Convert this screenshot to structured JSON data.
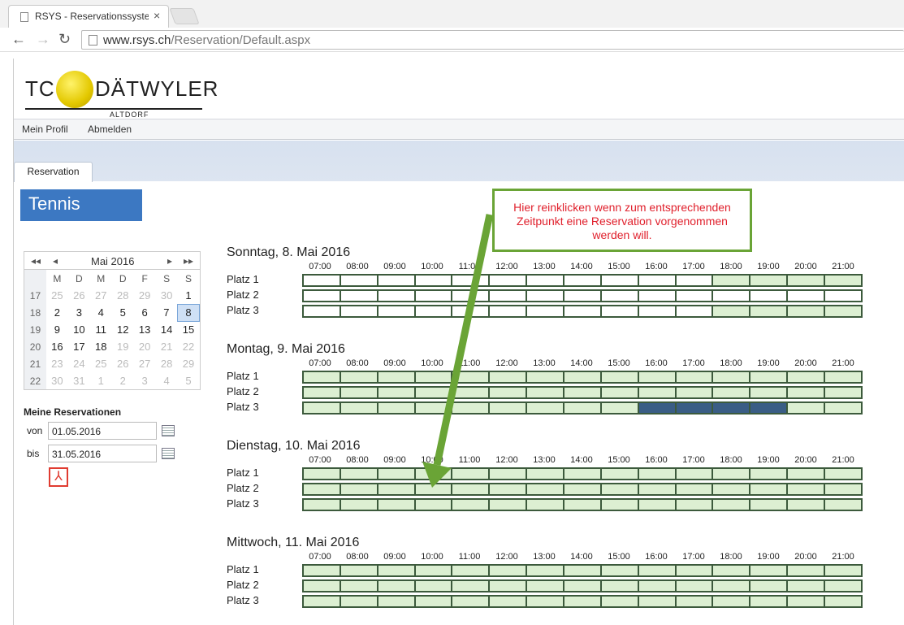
{
  "browser": {
    "tab_title": "RSYS - Reservationssyster",
    "url_host": "www.rsys.ch",
    "url_path": "/Reservation/Default.aspx"
  },
  "logo": {
    "tc": "TC",
    "name": "DÄTWYLER",
    "place": "ALTDORF"
  },
  "menu": {
    "profile": "Mein Profil",
    "logout": "Abmelden"
  },
  "tabs": {
    "reservation": "Reservation"
  },
  "section_title": "Tennis",
  "calendar": {
    "prev_year": "◂◂",
    "prev": "◂",
    "month": "Mai 2016",
    "next": "▸",
    "next_year": "▸▸",
    "dow": [
      "M",
      "D",
      "M",
      "D",
      "F",
      "S",
      "S"
    ],
    "weeks": [
      {
        "wk": "17",
        "days": [
          "25",
          "26",
          "27",
          "28",
          "29",
          "30",
          "1"
        ],
        "dim": [
          1,
          1,
          1,
          1,
          1,
          1,
          0
        ]
      },
      {
        "wk": "18",
        "days": [
          "2",
          "3",
          "4",
          "5",
          "6",
          "7",
          "8"
        ],
        "dim": [
          0,
          0,
          0,
          0,
          0,
          0,
          0
        ],
        "sel": 6
      },
      {
        "wk": "19",
        "days": [
          "9",
          "10",
          "11",
          "12",
          "13",
          "14",
          "15"
        ],
        "dim": [
          0,
          0,
          0,
          0,
          0,
          0,
          0
        ]
      },
      {
        "wk": "20",
        "days": [
          "16",
          "17",
          "18",
          "19",
          "20",
          "21",
          "22"
        ],
        "dim": [
          0,
          0,
          0,
          1,
          1,
          1,
          1
        ]
      },
      {
        "wk": "21",
        "days": [
          "23",
          "24",
          "25",
          "26",
          "27",
          "28",
          "29"
        ],
        "dim": [
          1,
          1,
          1,
          1,
          1,
          1,
          1
        ]
      },
      {
        "wk": "22",
        "days": [
          "30",
          "31",
          "1",
          "2",
          "3",
          "4",
          "5"
        ],
        "dim": [
          1,
          1,
          1,
          1,
          1,
          1,
          1
        ]
      }
    ]
  },
  "my_reservations": {
    "title": "Meine Reservationen",
    "from_label": "von",
    "from": "01.05.2016",
    "to_label": "bis",
    "to": "31.05.2016"
  },
  "hours": [
    "07:00",
    "08:00",
    "09:00",
    "10:00",
    "11:00",
    "12:00",
    "13:00",
    "14:00",
    "15:00",
    "16:00",
    "17:00",
    "18:00",
    "19:00",
    "20:00",
    "21:00"
  ],
  "days": [
    {
      "title": "Sonntag, 8. Mai 2016",
      "courts": [
        {
          "name": "Platz 1",
          "slots": "fffffffffffgggg"
        },
        {
          "name": "Platz 2",
          "slots": "fffffffffffffff"
        },
        {
          "name": "Platz 3",
          "slots": "fffffffffffgggg"
        }
      ]
    },
    {
      "title": "Montag, 9. Mai 2016",
      "courts": [
        {
          "name": "Platz 1",
          "slots": "ggggggggggggggg"
        },
        {
          "name": "Platz 2",
          "slots": "ggggggggggggggg"
        },
        {
          "name": "Platz 3",
          "slots": "gggggggggbbbbgg"
        }
      ]
    },
    {
      "title": "Dienstag, 10. Mai 2016",
      "courts": [
        {
          "name": "Platz 1",
          "slots": "ggggggggggggggg"
        },
        {
          "name": "Platz 2",
          "slots": "ggggggggggggggg"
        },
        {
          "name": "Platz 3",
          "slots": "ggggggggggggggg"
        }
      ]
    },
    {
      "title": "Mittwoch, 11. Mai 2016",
      "courts": [
        {
          "name": "Platz 1",
          "slots": "ggggggggggggggg"
        },
        {
          "name": "Platz 2",
          "slots": "ggggggggggggggg"
        },
        {
          "name": "Platz 3",
          "slots": "ggggggggggggggg"
        }
      ]
    }
  ],
  "callout": "Hier reinklicken wenn zum entsprechenden Zeitpunkt eine Reservation vorgenommen werden will."
}
